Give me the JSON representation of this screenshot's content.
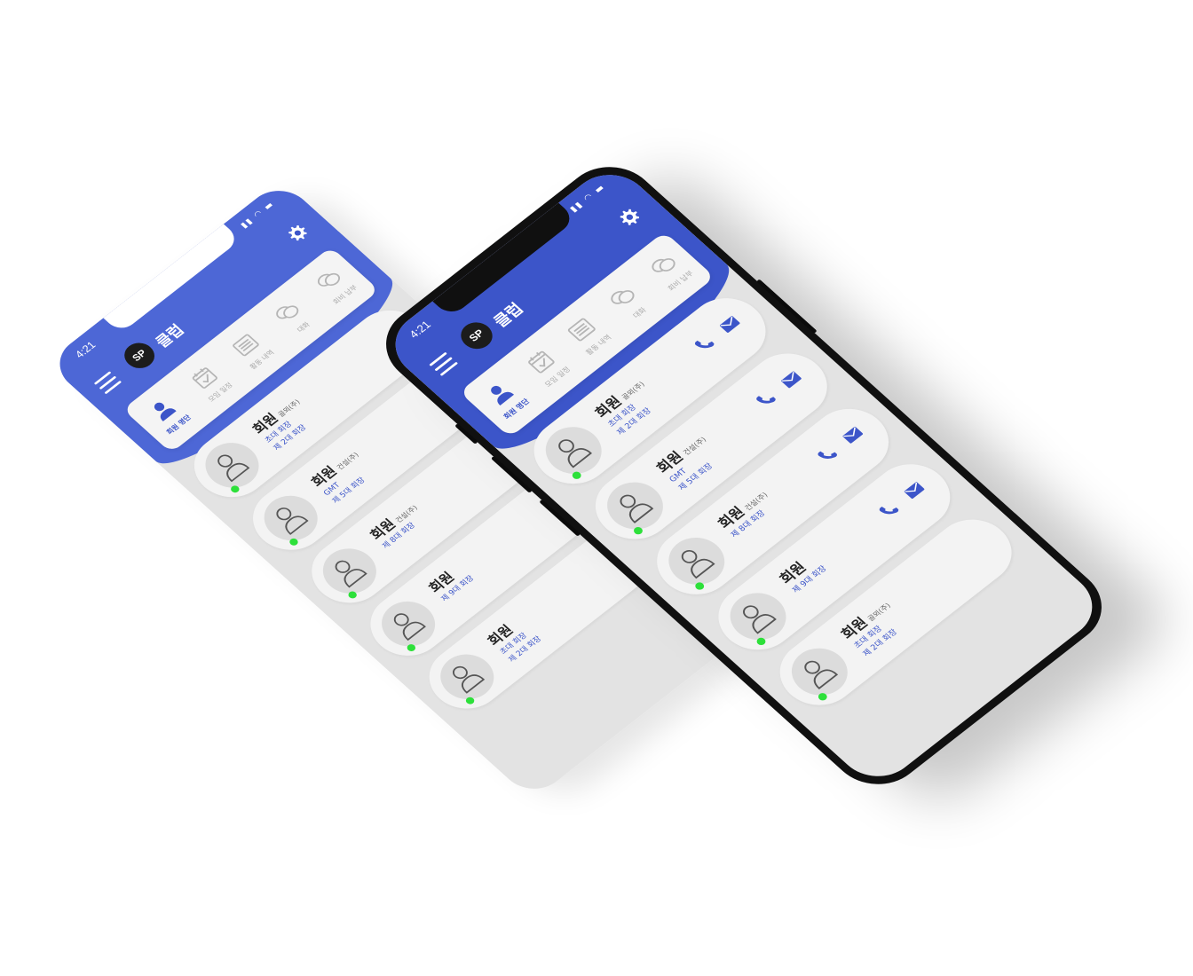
{
  "app": {
    "status_time": "4:21",
    "title": "클럽",
    "logo_text": "SP"
  },
  "colors": {
    "brand": "#3c55c9",
    "online": "#2de03a"
  },
  "tabs": [
    {
      "label": "회원 명단",
      "icon": "member-icon",
      "active": true
    },
    {
      "label": "모임 일정",
      "icon": "calendar-check-icon",
      "active": false
    },
    {
      "label": "활동 내역",
      "icon": "list-document-icon",
      "active": false
    },
    {
      "label": "대화",
      "icon": "chat-bubbles-icon",
      "active": false
    },
    {
      "label": "회비 납부",
      "icon": "chat-bubbles-icon",
      "active": false
    }
  ],
  "members_front": [
    {
      "name": "회원",
      "company": "골뫼(주)",
      "roles": [
        "초대 회장",
        "제 2대 회장"
      ]
    },
    {
      "name": "회원",
      "company": "건설(주)",
      "roles": [
        "GMT",
        "제 5대 회장"
      ]
    },
    {
      "name": "회원",
      "company": "건설(주)",
      "roles": [
        "제 8대 회장"
      ]
    },
    {
      "name": "회원",
      "company": "",
      "roles": [
        "제 9대 회장"
      ]
    },
    {
      "name": "회원",
      "company": "골뫼(주)",
      "roles": [
        "초대 회장",
        "제 2대 회장"
      ]
    }
  ],
  "members_back": [
    {
      "name": "회원",
      "company": "골뫼(주)",
      "roles": [
        "초대 회장",
        "제 2대 회장"
      ]
    },
    {
      "name": "회원",
      "company": "건설(주)",
      "roles": [
        "GMT",
        "제 5대 회장"
      ]
    },
    {
      "name": "회원",
      "company": "건설(주)",
      "roles": [
        "제 8대 회장"
      ]
    },
    {
      "name": "회원",
      "company": "",
      "roles": [
        "제 9대 회장"
      ]
    },
    {
      "name": "회원",
      "company": "",
      "roles": [
        "초대 회장",
        "제 2대 회장"
      ]
    }
  ]
}
